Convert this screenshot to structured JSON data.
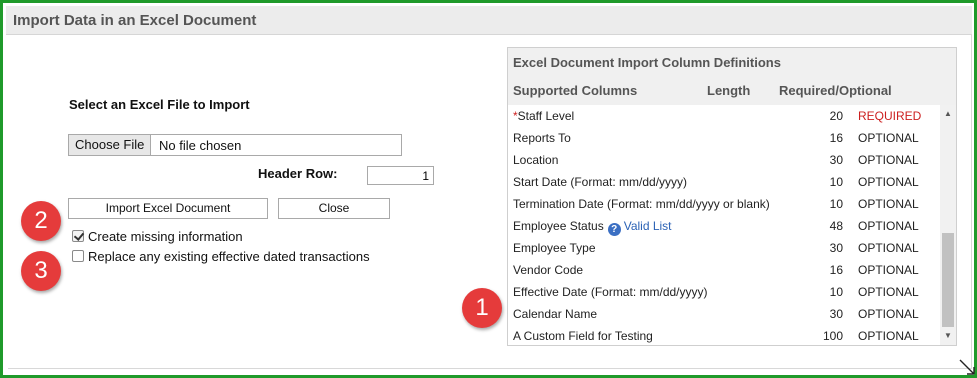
{
  "window": {
    "title": "Import Data in an Excel Document"
  },
  "form": {
    "select_label": "Select an Excel File to Import",
    "choose_file_label": "Choose File",
    "file_status": "No file chosen",
    "header_row_label": "Header Row:",
    "header_row_value": "1",
    "import_button": "Import Excel Document",
    "close_button": "Close",
    "create_missing_label": "Create missing information",
    "create_missing_checked": true,
    "replace_label": "Replace any existing effective dated transactions",
    "replace_checked": false
  },
  "badges": {
    "one": "1",
    "two": "2",
    "three": "3"
  },
  "definitions": {
    "title": "Excel Document Import Column Definitions",
    "col_supported": "Supported Columns",
    "col_length": "Length",
    "col_required": "Required/Optional",
    "rows": [
      {
        "asterisk": "*",
        "name": "Staff Level",
        "length": "20",
        "req": "REQUIRED"
      },
      {
        "name": "Reports To",
        "length": "16",
        "req": "OPTIONAL"
      },
      {
        "name": "Location",
        "length": "30",
        "req": "OPTIONAL"
      },
      {
        "name": "Start Date  (Format: mm/dd/yyyy)",
        "length": "10",
        "req": "OPTIONAL"
      },
      {
        "name": "Termination Date  (Format: mm/dd/yyyy or blank)",
        "length": "10",
        "req": "OPTIONAL"
      },
      {
        "name": "Employee Status",
        "link": "Valid List",
        "length": "48",
        "req": "OPTIONAL"
      },
      {
        "name": "Employee Type",
        "length": "30",
        "req": "OPTIONAL"
      },
      {
        "name": "Vendor Code",
        "length": "16",
        "req": "OPTIONAL"
      },
      {
        "name": "Effective Date  (Format: mm/dd/yyyy)",
        "length": "10",
        "req": "OPTIONAL"
      },
      {
        "name": "Calendar Name",
        "length": "30",
        "req": "OPTIONAL"
      },
      {
        "name": "A Custom Field for Testing",
        "length": "100",
        "req": "OPTIONAL"
      }
    ]
  },
  "colors": {
    "frame": "#1f9a2a",
    "badge": "#e53b3b",
    "required": "#cc1f1f",
    "link": "#2b62b5"
  },
  "icons": {
    "help": "question-circle-icon",
    "scroll_up": "arrow-up-icon",
    "scroll_down": "arrow-down-icon"
  }
}
